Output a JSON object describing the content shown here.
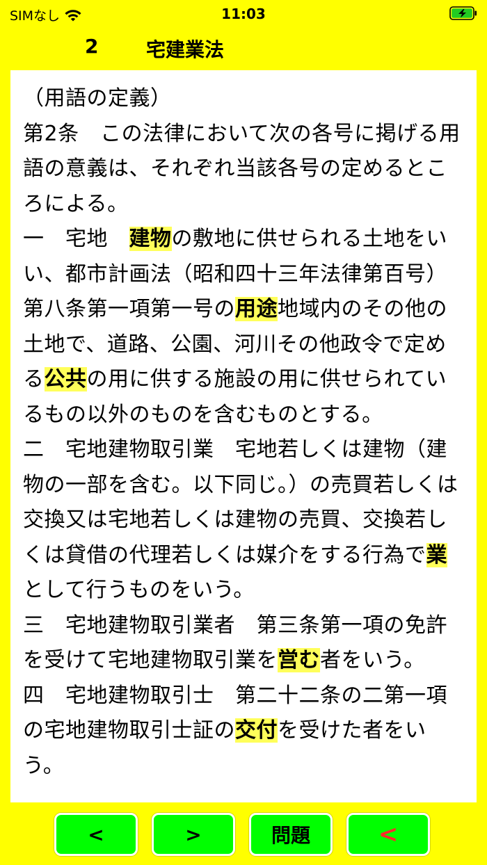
{
  "status_bar": {
    "carrier": "SIMなし",
    "time": "11:03",
    "wifi_icon": "wifi-icon",
    "battery_icon": "battery-charging-icon",
    "battery_color": "#22cc22"
  },
  "header": {
    "number": "2",
    "title": "宅建業法"
  },
  "article": {
    "segments": [
      {
        "t": "（用語の定義）\n第2条　この法律において次の各号に掲げる用語の意義は、それぞれ当該各号の定めるところによる。\n一　宅地　"
      },
      {
        "t": "建物",
        "h": true
      },
      {
        "t": "の敷地に供せられる土地をいい、都市計画法（昭和四十三年法律第百号）第八条第一項第一号の"
      },
      {
        "t": "用途",
        "h": true
      },
      {
        "t": "地域内のその他の土地で、道路、公園、河川その他政令で定める"
      },
      {
        "t": "公共",
        "h": true
      },
      {
        "t": "の用に供する施設の用に供せられているもの以外のものを含むものとする。\n二　宅地建物取引業　宅地若しくは建物（建物の一部を含む。以下同じ。）の売買若しくは交換又は宅地若しくは建物の売買、交換若しくは貸借の代理若しくは媒介をする行為で"
      },
      {
        "t": "業",
        "h": true
      },
      {
        "t": "として行うものをいう。\n三　宅地建物取引業者　第三条第一項の免許を受けて宅地建物取引業を"
      },
      {
        "t": "営む",
        "h": true
      },
      {
        "t": "者をいう。\n四　宅地建物取引士　第二十二条の二第一項の宅地建物取引士証の"
      },
      {
        "t": "交付",
        "h": true
      },
      {
        "t": "を受けた者をいう。"
      }
    ]
  },
  "buttons": {
    "prev": "<",
    "next": ">",
    "question": "問題",
    "back": "<"
  },
  "colors": {
    "background": "#ffff00",
    "button": "#00ff00",
    "highlight": "#ffff5a",
    "back_arrow": "#ff2a2a"
  }
}
